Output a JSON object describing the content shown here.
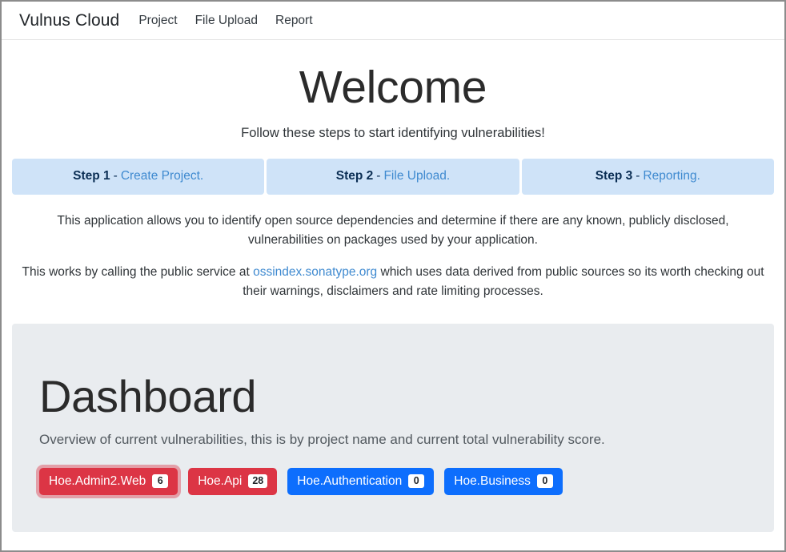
{
  "navbar": {
    "brand": "Vulnus Cloud",
    "links": [
      {
        "label": "Project"
      },
      {
        "label": "File Upload"
      },
      {
        "label": "Report"
      }
    ]
  },
  "hero": {
    "title": "Welcome",
    "subtitle": "Follow these steps to start identifying vulnerabilities!"
  },
  "steps": [
    {
      "label": "Step 1",
      "dash": "-",
      "link": "Create Project."
    },
    {
      "label": "Step 2",
      "dash": "-",
      "link": "File Upload."
    },
    {
      "label": "Step 3",
      "dash": "-",
      "link": "Reporting."
    }
  ],
  "intro": {
    "paragraph1": "This application allows you to identify open source dependencies and determine if there are any known, publicly disclosed, vulnerabilities on packages used by your application.",
    "paragraph2_before": "This works by calling the public service at ",
    "paragraph2_link": "ossindex.sonatype.org",
    "paragraph2_after": " which uses data derived from public sources so its worth checking out their warnings, disclaimers and rate limiting processes."
  },
  "dashboard": {
    "title": "Dashboard",
    "subtitle": "Overview of current vulnerabilities, this is by project name and current total vulnerability score.",
    "projects": [
      {
        "name": "Hoe.Admin2.Web",
        "count": "6",
        "severity": "danger",
        "focused": true
      },
      {
        "name": "Hoe.Api",
        "count": "28",
        "severity": "danger",
        "focused": false
      },
      {
        "name": "Hoe.Authentication",
        "count": "0",
        "severity": "primary",
        "focused": false
      },
      {
        "name": "Hoe.Business",
        "count": "0",
        "severity": "primary",
        "focused": false
      }
    ]
  },
  "colors": {
    "danger": "#dc3545",
    "primary": "#0d6efd",
    "step_bg": "#cfe3f8",
    "step_text": "#0b2e54",
    "link": "#3f8ad0",
    "jumbotron_bg": "#e9ecef"
  }
}
